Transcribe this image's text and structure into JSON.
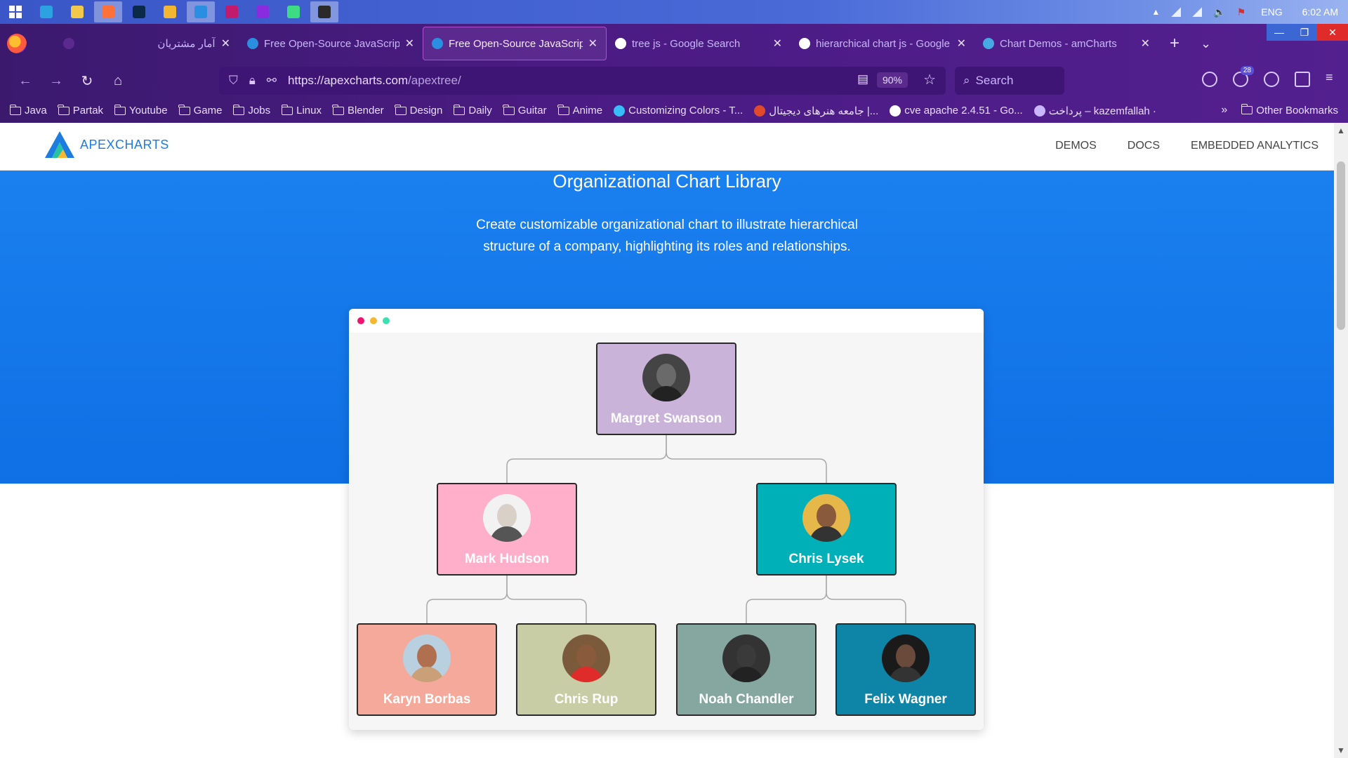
{
  "taskbar": {
    "apps": [
      {
        "name": "start",
        "color": "#ffffff"
      },
      {
        "name": "telegram",
        "color": "#2aa3e0"
      },
      {
        "name": "explorer",
        "color": "#f2c84b"
      },
      {
        "name": "firefox",
        "color": "#ff7139",
        "active": true
      },
      {
        "name": "photoshop",
        "color": "#0b2a4a"
      },
      {
        "name": "hand-app",
        "color": "#f2b632"
      },
      {
        "name": "vscode",
        "color": "#2a8fe0",
        "active": true
      },
      {
        "name": "intellij",
        "color": "#c21a6c"
      },
      {
        "name": "phpstorm",
        "color": "#8a2be2"
      },
      {
        "name": "android-studio",
        "color": "#3ddc84"
      },
      {
        "name": "terminal-app",
        "color": "#2a2a2a",
        "active": true
      }
    ],
    "language": "ENG",
    "time": "6:02 AM"
  },
  "browser": {
    "tabs": [
      {
        "title": "آمار مشتریان",
        "favicon_color": "#5b2a8e"
      },
      {
        "title": "Free Open-Source JavaScript",
        "favicon_color": "#2a8fe0"
      },
      {
        "title": "Free Open-Source JavaScript",
        "favicon_color": "#2a8fe0",
        "active": true
      },
      {
        "title": "tree js - Google Search",
        "favicon_color": "#ffffff"
      },
      {
        "title": "hierarchical chart js - Google",
        "favicon_color": "#ffffff"
      },
      {
        "title": "Chart Demos - amCharts",
        "favicon_color": "#47a8e6"
      }
    ],
    "url_base": "https://apexcharts.com",
    "url_path": "/apextree/",
    "zoom": "90%",
    "search_placeholder": "Search",
    "extension_badge": "28",
    "bookmarks": [
      {
        "label": "Java",
        "type": "folder"
      },
      {
        "label": "Partak",
        "type": "folder"
      },
      {
        "label": "Youtube",
        "type": "folder"
      },
      {
        "label": "Game",
        "type": "folder"
      },
      {
        "label": "Jobs",
        "type": "folder"
      },
      {
        "label": "Linux",
        "type": "folder"
      },
      {
        "label": "Blender",
        "type": "folder"
      },
      {
        "label": "Design",
        "type": "folder"
      },
      {
        "label": "Daily",
        "type": "folder"
      },
      {
        "label": "Guitar",
        "type": "folder"
      },
      {
        "label": "Anime",
        "type": "folder"
      },
      {
        "label": "Customizing Colors - T...",
        "type": "link",
        "color": "#38bdf8"
      },
      {
        "label": "جامعه هنرهای دیجیتال |...",
        "type": "link",
        "color": "#e04a2a"
      },
      {
        "label": "cve apache 2.4.51 - Go...",
        "type": "link",
        "color": "#ffffff"
      },
      {
        "label": "پرداخت – kazemfallah ·",
        "type": "link",
        "color": "#c9b6ff"
      }
    ],
    "other_bookmarks": "Other Bookmarks"
  },
  "site": {
    "logo_text": "APEXCHARTS",
    "nav": [
      "DEMOS",
      "DOCS",
      "EMBEDDED ANALYTICS"
    ],
    "hero_title": "Organizational Chart Library",
    "hero_text": "Create customizable organizational chart to illustrate hierarchical structure of a company, highlighting its roles and relationships."
  },
  "org_chart": {
    "window_dots": [
      "#f0146e",
      "#f5b82e",
      "#3de0b0"
    ],
    "nodes": [
      {
        "name": "Margret Swanson",
        "color": "#c9b3d9",
        "level": 0
      },
      {
        "name": "Mark Hudson",
        "color": "#ffafc9",
        "level": 1,
        "parent": 0
      },
      {
        "name": "Chris Lysek",
        "color": "#00b0b9",
        "level": 1,
        "parent": 0
      },
      {
        "name": "Karyn Borbas",
        "color": "#f5a99a",
        "level": 2,
        "parent": 1
      },
      {
        "name": "Chris Rup",
        "color": "#c9cda6",
        "level": 2,
        "parent": 1
      },
      {
        "name": "Noah Chandler",
        "color": "#86a7a0",
        "level": 2,
        "parent": 2
      },
      {
        "name": "Felix Wagner",
        "color": "#0e84a6",
        "level": 2,
        "parent": 2
      }
    ]
  }
}
